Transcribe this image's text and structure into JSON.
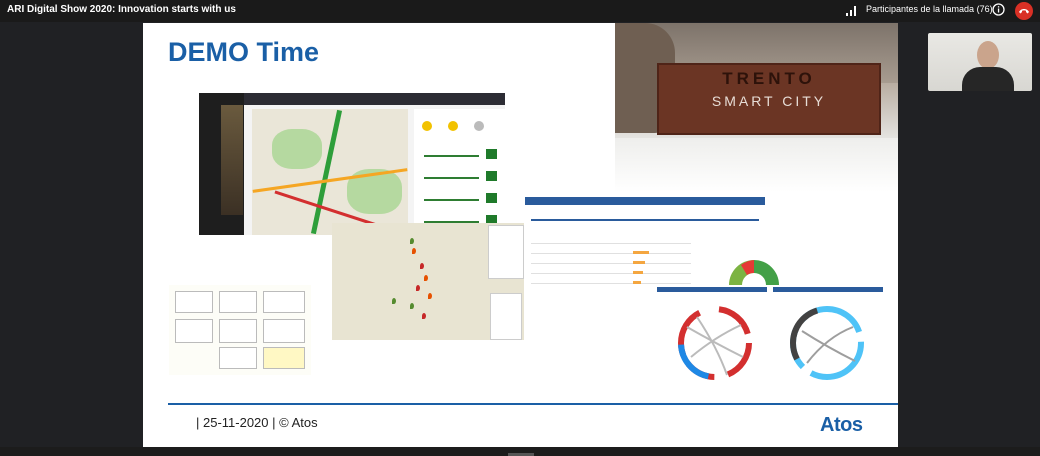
{
  "app": {
    "meeting_title": "ARI Digital Show 2020: Innovation starts with us",
    "participants_label": "Participantes de la llamada",
    "participants_count": "(76)"
  },
  "icons": {
    "signal": "signal-bars-icon",
    "info": "info-icon",
    "hangup": "hang-up-icon"
  },
  "colors": {
    "hangup": "#d93025",
    "slide_accent": "#1a5fa6"
  },
  "slide": {
    "title": "DEMO Time",
    "footer": "| 25-11-2020 | © Atos",
    "logo": "Atos",
    "photo_sign": {
      "name": "TRENTO",
      "subtitle": "SMART CITY"
    }
  }
}
